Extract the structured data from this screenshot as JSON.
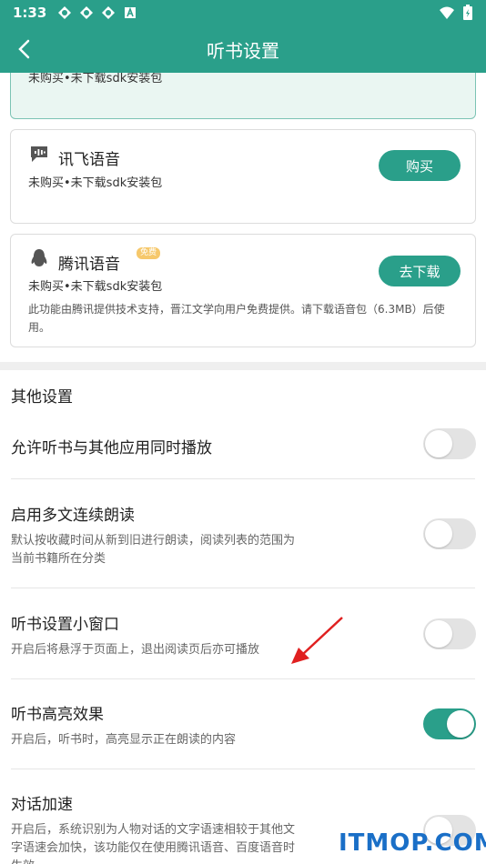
{
  "status_bar": {
    "time": "1:33",
    "icons": [
      "app-icon",
      "app-icon",
      "app-icon",
      "a-icon"
    ],
    "right_icons": [
      "wifi-icon",
      "battery-icon"
    ]
  },
  "app_bar": {
    "title": "听书设置",
    "back_icon": "back-arrow-icon"
  },
  "voice_cards": [
    {
      "name": "",
      "status": "未购买•未下载sdk安装包",
      "button": "",
      "selected": true
    },
    {
      "name": "讯飞语音",
      "status": "未购买•未下载sdk安装包",
      "button": "购买",
      "icon": "chat-bubble-icon"
    },
    {
      "name": "腾讯语音",
      "badge": "免费",
      "status": "未购买•未下载sdk安装包",
      "button": "去下载",
      "icon": "penguin-icon",
      "description": "此功能由腾讯提供技术支持，晋江文学向用户免费提供。请下载语音包（6.3MB）后使用。"
    }
  ],
  "other_settings": {
    "section_title": "其他设置",
    "items": [
      {
        "title": "允许听书与其他应用同时播放",
        "desc": "",
        "enabled": false
      },
      {
        "title": "启用多文连续朗读",
        "desc": "默认按收藏时间从新到旧进行朗读，阅读列表的范围为当前书籍所在分类",
        "enabled": false
      },
      {
        "title": "听书设置小窗口",
        "desc": "开启后将悬浮于页面上，退出阅读页后亦可播放",
        "enabled": false
      },
      {
        "title": "听书高亮效果",
        "desc": "开启后，听书时，高亮显示正在朗读的内容",
        "enabled": true
      },
      {
        "title": "对话加速",
        "desc": "开启后，系统识别为人物对话的文字语速相较于其他文字语速会加快，该功能仅在使用腾讯语音、百度语音时生效",
        "enabled": false
      }
    ]
  },
  "watermark": "ITMOP.COM",
  "colors": {
    "accent": "#2a9f8a",
    "toggle_off": "#e3e3e3",
    "watermark": "#1a6fc7",
    "arrow": "#e02020"
  }
}
